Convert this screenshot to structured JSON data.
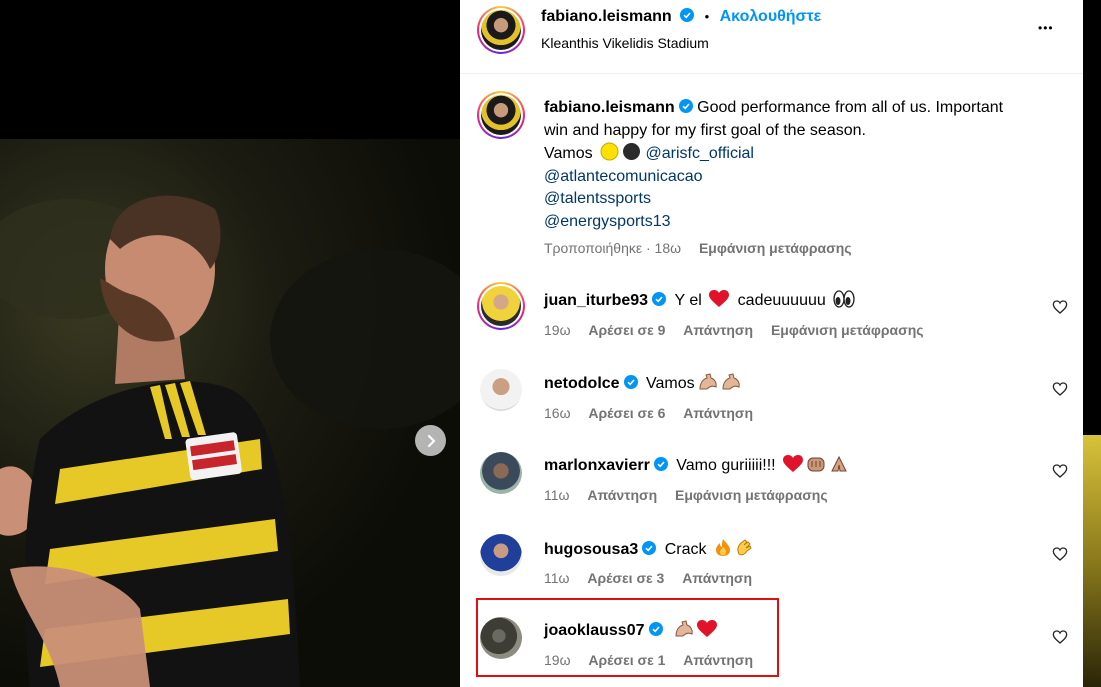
{
  "post": {
    "author": "fabiano.leismann",
    "location": "Kleanthis Vikelidis Stadium",
    "follow_label": "Ακολουθήστε",
    "separator": "•",
    "more_label": "•••",
    "caption_line1": "Good performance from all of us. Important",
    "caption_line2": "win and happy for my first goal of the season.",
    "caption_vamos": "Vamos",
    "mentions": [
      "@arisfc_official",
      "@atlantecomunicacao",
      "@talentssports",
      "@energysports13"
    ],
    "edited_label": "Τροποποιήθηκε · 18ω",
    "translate_label": "Εμφάνιση μετάφρασης"
  },
  "comments": [
    {
      "user": "juan_iturbe93",
      "text": "Y el",
      "text2": "cadeuuuuuu",
      "time": "19ω",
      "likes": "Αρέσει σε 9",
      "reply": "Απάντηση",
      "translate": "Εμφάνιση μετάφρασης"
    },
    {
      "user": "netodolce",
      "text": "Vamos",
      "time": "16ω",
      "likes": "Αρέσει σε 6",
      "reply": "Απάντηση"
    },
    {
      "user": "marlonxavierr",
      "text": "Vamo guriiiii!!!",
      "time": "11ω",
      "reply": "Απάντηση",
      "translate": "Εμφάνιση μετάφρασης"
    },
    {
      "user": "hugosousa3",
      "text": "Crack",
      "time": "11ω",
      "likes": "Αρέσει σε 3",
      "reply": "Απάντηση"
    },
    {
      "user": "joaoklauss07",
      "text": "",
      "time": "19ω",
      "likes": "Αρέσει σε 1",
      "reply": "Απάντηση"
    }
  ],
  "colors": {
    "accent": "#0095f6",
    "mention": "#00376b",
    "muted": "#737373",
    "highlight": "#e01010"
  },
  "icons": [
    "verified-badge-icon",
    "heart-outline-icon",
    "chevron-right-icon",
    "more-options-icon"
  ]
}
